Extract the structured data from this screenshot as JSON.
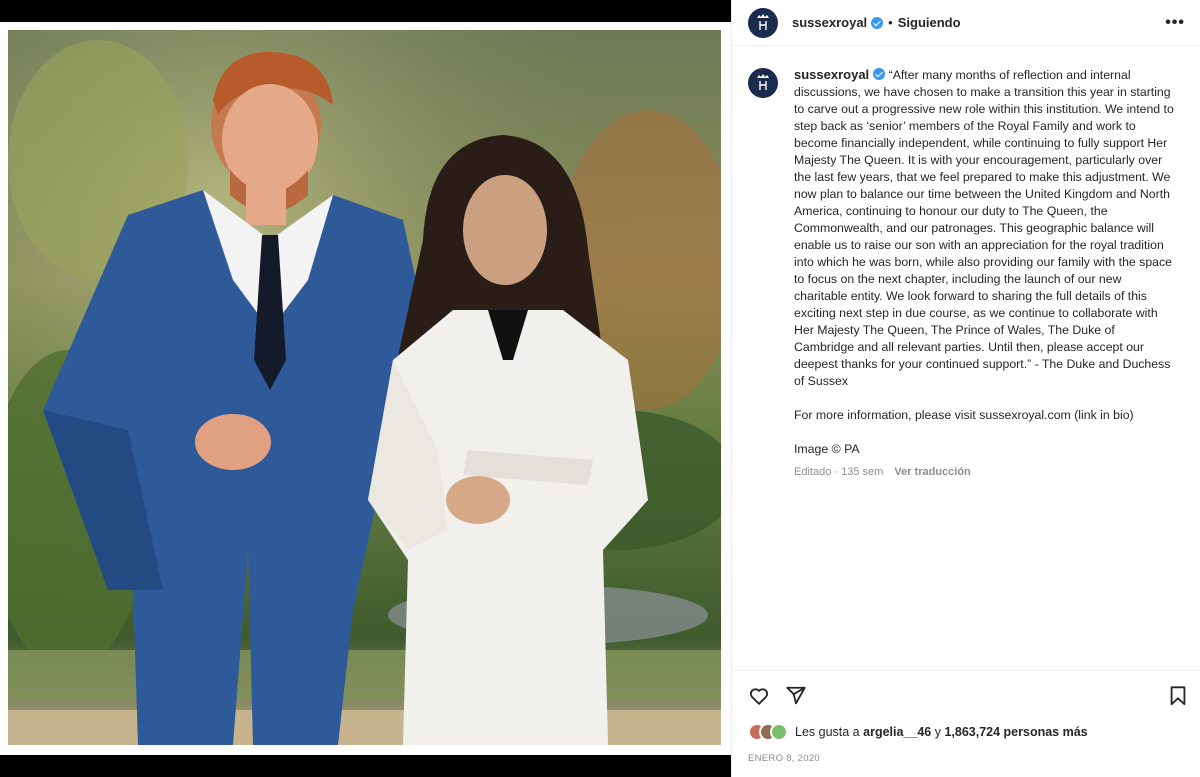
{
  "post": {
    "username": "sussexroyal",
    "follow_status": "Siguiendo",
    "separator": "•",
    "more_label": "•••",
    "caption": "“After many months of reflection and internal discussions, we have chosen to make a transition this year in starting to carve out a progressive new role within this institution. We intend to step back as ‘senior’ members of the Royal Family and work to become financially independent, while continuing to fully support Her Majesty The Queen. It is with your encouragement, particularly over the last few years, that we feel prepared to make this adjustment. We now plan to balance our time between the United Kingdom and North America, continuing to honour our duty to The Queen, the Commonwealth, and our patronages. This geographic balance will enable us to raise our son with an appreciation for the royal tradition into which he was born, while also providing our family with the space to focus on the next chapter, including the launch of our new charitable entity. We look forward to sharing the full details of this exciting next step in due course, as we continue to collaborate with Her Majesty The Queen, The Prince of Wales, The Duke of Cambridge and all relevant parties. Until then, please accept our deepest thanks for your continued support.” - The Duke and Duchess of Sussex",
    "more_info": "For more information, please visit sussexroyal.com (link in bio)",
    "image_credit": "Image © PA",
    "edited_meta": "Editado · 135 sem",
    "translate_label": "Ver traducción",
    "likes_prefix": "Les gusta a",
    "liked_by_user": "argelia__46",
    "likes_conjunction": "y",
    "likes_count_text": "1,863,724 personas más",
    "date": "ENERO 8, 2020"
  },
  "icons": {
    "verified": "verified-badge-icon",
    "like": "heart-icon",
    "share": "paper-plane-icon",
    "save": "bookmark-icon",
    "more": "ellipsis-icon"
  },
  "colors": {
    "verified_blue": "#3897f0",
    "avatar_navy": "#1b2b4d",
    "muted_text": "#8e8e8e",
    "border": "#efefef"
  }
}
